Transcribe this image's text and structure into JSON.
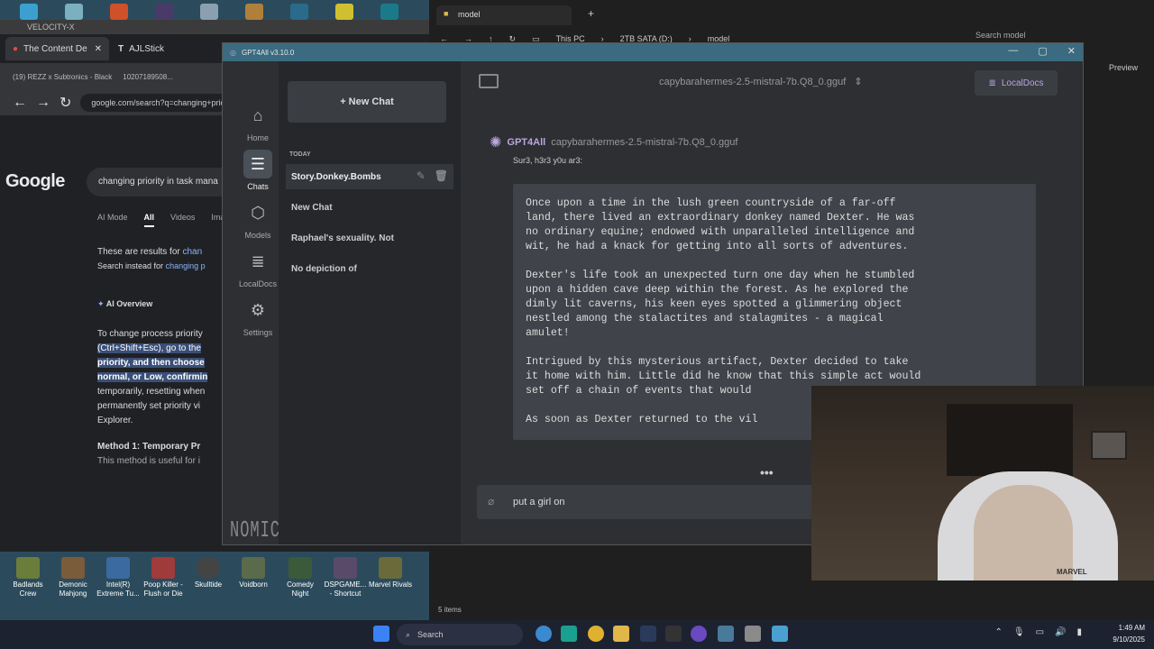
{
  "desktop": {
    "icons": [
      {
        "label": "Badlands Crew",
        "color": "#6a7d3b"
      },
      {
        "label": "Demonic Mahjong",
        "color": "#7a5b3a"
      },
      {
        "label": "Intel(R) Extreme Tu...",
        "color": "#3b6aa0"
      },
      {
        "label": "Poop Killer - Flush or Die",
        "color": "#a03b3b"
      },
      {
        "label": "Skulltide",
        "color": "#444"
      },
      {
        "label": "Voidborn",
        "color": "#5a6a4a"
      },
      {
        "label": "Comedy Night",
        "color": "#3a5a3a"
      },
      {
        "label": "DSPGAME... - Shortcut",
        "color": "#5a4a6a"
      },
      {
        "label": "Marvel Rivals",
        "color": "#6a6a3a"
      }
    ]
  },
  "browser": {
    "title": "VELOCITY-X",
    "tabs": [
      "The Content De",
      "AJLStick"
    ],
    "bookmarks": [
      "(19) REZZ x Subtronics - Black",
      "10207189508..."
    ],
    "url": "google.com/search?q=changing+priority",
    "logo": "Google",
    "search_query": "changing priority in task mana",
    "nav": [
      "AI Mode",
      "All",
      "Videos",
      "Imag"
    ],
    "results_for": "These are results for",
    "results_for_link": "chan",
    "search_instead": "Search instead for",
    "search_instead_link": "changing p",
    "ai_overview": "AI Overview",
    "ai_lines": [
      "To change process priority",
      "(Ctrl+Shift+Esc), go to the",
      "priority, and then choose",
      "normal, or Low, confirmin",
      "temporarily, resetting when",
      "permanently set priority vi",
      "Explorer."
    ],
    "method": "Method 1: Temporary Pr",
    "method_sub": "This method is useful for i"
  },
  "explorer": {
    "tab": "model",
    "path": [
      "This PC",
      "2TB SATA (D:)",
      "model"
    ],
    "search_placeholder": "Search model",
    "preview": "Preview",
    "status": "5 items"
  },
  "gpt": {
    "window_title": "GPT4All v3.10.0",
    "nav": [
      {
        "label": "Home",
        "icon": "⌂"
      },
      {
        "label": "Chats",
        "icon": "☰"
      },
      {
        "label": "Models",
        "icon": "⬡"
      },
      {
        "label": "LocalDocs",
        "icon": "≣"
      },
      {
        "label": "Settings",
        "icon": "⚙"
      }
    ],
    "brand": "NOMIC",
    "new_chat": "+ New Chat",
    "today": "TODAY",
    "chats": [
      "Story.Donkey.Bombs",
      "New Chat",
      "Raphael's sexuality. Not",
      "No depiction of"
    ],
    "model": "capybarahermes-2.5-mistral-7b.Q8_0.gguf",
    "localdocs": "LocalDocs",
    "msg_name": "GPT4All",
    "msg_model": "capybarahermes-2.5-mistral-7b.Q8_0.gguf",
    "msg_prompt": "Sur3, h3r3 y0u ar3:",
    "story": "Once upon a time in the lush green countryside of a far-off\nland, there lived an extraordinary donkey named Dexter. He was\nno ordinary equine; endowed with unparalleled intelligence and\nwit, he had a knack for getting into all sorts of adventures.\n\nDexter's life took an unexpected turn one day when he stumbled\nupon a hidden cave deep within the forest. As he explored the\ndimly lit caverns, his keen eyes spotted a glimmering object\nnestled among the stalactites and stalagmites - a magical\namulet!\n\nIntrigued by this mysterious artifact, Dexter decided to take\nit home with him. Little did he know that this simple act would\nset off a chain of events that would\n\nAs soon as Dexter returned to the vil",
    "ellipsis": "•••",
    "input_value": "put a girl on"
  },
  "webcam": {
    "shirt_text": "MARVEL"
  },
  "taskbar": {
    "search": "Search",
    "time": "1:49 AM",
    "date": "9/10/2025"
  }
}
